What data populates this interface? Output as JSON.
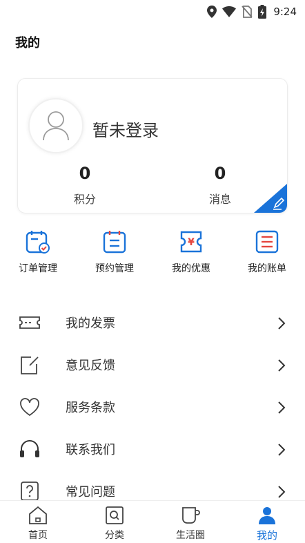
{
  "status_bar": {
    "time": "9:24"
  },
  "page": {
    "title": "我的"
  },
  "profile": {
    "login_text": "暂未登录",
    "points": {
      "value": "0",
      "label": "积分"
    },
    "messages": {
      "value": "0",
      "label": "消息"
    }
  },
  "quick_actions": [
    {
      "label": "订单管理",
      "icon": "order-calendar-icon"
    },
    {
      "label": "预约管理",
      "icon": "appointment-calendar-icon"
    },
    {
      "label": "我的优惠",
      "icon": "coupon-yen-icon"
    },
    {
      "label": "我的账单",
      "icon": "bill-list-icon"
    }
  ],
  "menu": [
    {
      "label": "我的发票",
      "icon": "invoice-icon"
    },
    {
      "label": "意见反馈",
      "icon": "feedback-edit-icon"
    },
    {
      "label": "服务条款",
      "icon": "heart-icon"
    },
    {
      "label": "联系我们",
      "icon": "headphones-icon"
    },
    {
      "label": "常见问题",
      "icon": "question-icon"
    }
  ],
  "tabs": [
    {
      "label": "首页",
      "icon": "home-icon"
    },
    {
      "label": "分类",
      "icon": "category-search-icon"
    },
    {
      "label": "生活圈",
      "icon": "cup-icon"
    },
    {
      "label": "我的",
      "icon": "user-icon",
      "active": true
    }
  ],
  "colors": {
    "accent": "#1a73d9",
    "icon_blue": "#1a73d9",
    "icon_orange": "#f07a4a",
    "icon_red": "#e5463f"
  }
}
